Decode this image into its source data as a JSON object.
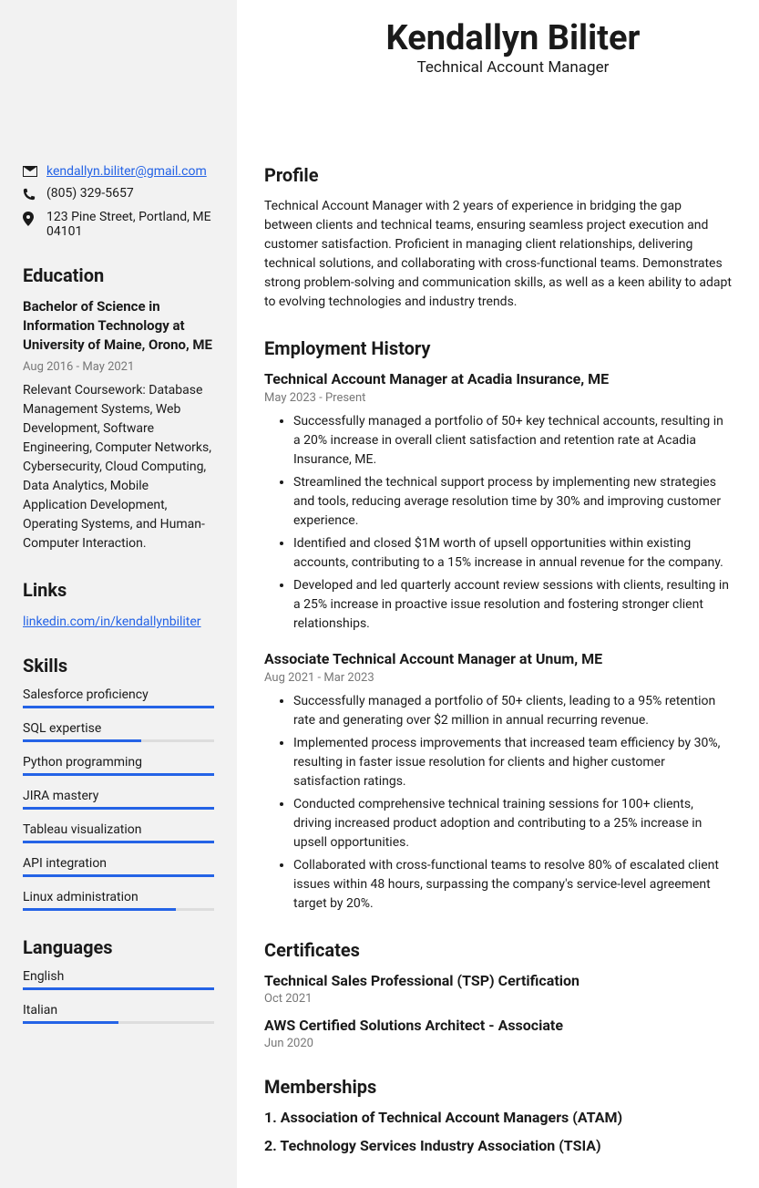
{
  "name": "Kendallyn Biliter",
  "title": "Technical Account Manager",
  "contact": {
    "email": "kendallyn.biliter@gmail.com",
    "phone": "(805) 329-5657",
    "address": "123 Pine Street, Portland, ME 04101"
  },
  "education": {
    "heading": "Education",
    "degree": "Bachelor of Science in Information Technology at University of Maine, Orono, ME",
    "dates": "Aug 2016 - May 2021",
    "desc": "Relevant Coursework: Database Management Systems, Web Development, Software Engineering, Computer Networks, Cybersecurity, Cloud Computing, Data Analytics, Mobile Application Development, Operating Systems, and Human-Computer Interaction."
  },
  "links": {
    "heading": "Links",
    "items": [
      {
        "label": "linkedin.com/in/kendallynbiliter"
      }
    ]
  },
  "skills": {
    "heading": "Skills",
    "items": [
      {
        "name": "Salesforce proficiency",
        "level": 100
      },
      {
        "name": "SQL expertise",
        "level": 62
      },
      {
        "name": "Python programming",
        "level": 100
      },
      {
        "name": "JIRA mastery",
        "level": 100
      },
      {
        "name": "Tableau visualization",
        "level": 100
      },
      {
        "name": "API integration",
        "level": 100
      },
      {
        "name": "Linux administration",
        "level": 80
      }
    ]
  },
  "languages": {
    "heading": "Languages",
    "items": [
      {
        "name": "English",
        "level": 100
      },
      {
        "name": "Italian",
        "level": 50
      }
    ]
  },
  "profile": {
    "heading": "Profile",
    "text": "Technical Account Manager with 2 years of experience in bridging the gap between clients and technical teams, ensuring seamless project execution and customer satisfaction. Proficient in managing client relationships, delivering technical solutions, and collaborating with cross-functional teams. Demonstrates strong problem-solving and communication skills, as well as a keen ability to adapt to evolving technologies and industry trends."
  },
  "employment": {
    "heading": "Employment History",
    "jobs": [
      {
        "title": "Technical Account Manager at Acadia Insurance, ME",
        "dates": "May 2023 - Present",
        "bullets": [
          "Successfully managed a portfolio of 50+ key technical accounts, resulting in a 20% increase in overall client satisfaction and retention rate at Acadia Insurance, ME.",
          "Streamlined the technical support process by implementing new strategies and tools, reducing average resolution time by 30% and improving customer experience.",
          "Identified and closed $1M worth of upsell opportunities within existing accounts, contributing to a 15% increase in annual revenue for the company.",
          "Developed and led quarterly account review sessions with clients, resulting in a 25% increase in proactive issue resolution and fostering stronger client relationships."
        ]
      },
      {
        "title": "Associate Technical Account Manager at Unum, ME",
        "dates": "Aug 2021 - Mar 2023",
        "bullets": [
          "Successfully managed a portfolio of 50+ clients, leading to a 95% retention rate and generating over $2 million in annual recurring revenue.",
          "Implemented process improvements that increased team efficiency by 30%, resulting in faster issue resolution for clients and higher customer satisfaction ratings.",
          "Conducted comprehensive technical training sessions for 100+ clients, driving increased product adoption and contributing to a 25% increase in upsell opportunities.",
          "Collaborated with cross-functional teams to resolve 80% of escalated client issues within 48 hours, surpassing the company's service-level agreement target by 20%."
        ]
      }
    ]
  },
  "certificates": {
    "heading": "Certificates",
    "items": [
      {
        "title": "Technical Sales Professional (TSP) Certification",
        "date": "Oct 2021"
      },
      {
        "title": "AWS Certified Solutions Architect - Associate",
        "date": "Jun 2020"
      }
    ]
  },
  "memberships": {
    "heading": "Memberships",
    "items": [
      "1. Association of Technical Account Managers (ATAM)",
      "2. Technology Services Industry Association (TSIA)"
    ]
  }
}
